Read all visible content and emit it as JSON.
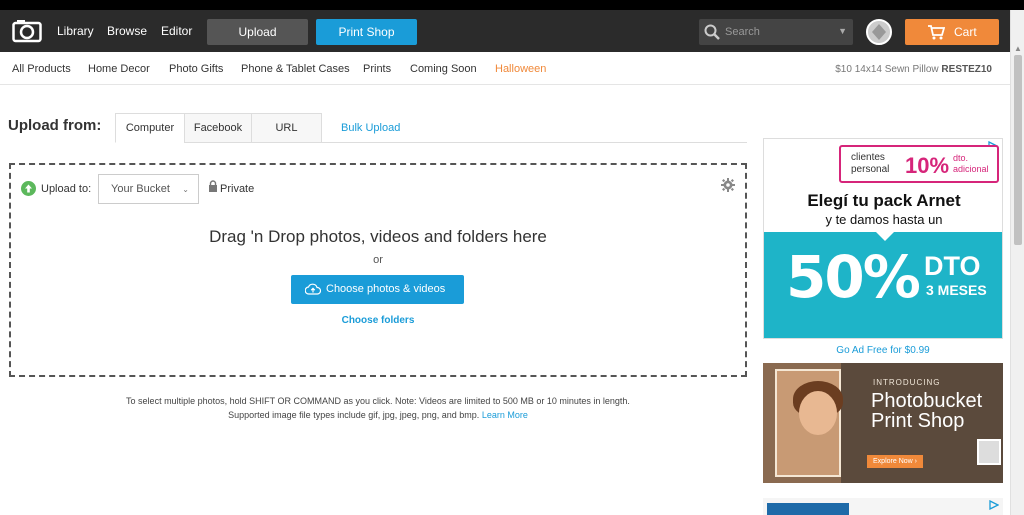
{
  "nav": {
    "items": [
      "Library",
      "Browse",
      "Editor"
    ],
    "upload_label": "Upload",
    "print_shop_label": "Print Shop",
    "search_placeholder": "Search",
    "cart_label": "Cart"
  },
  "categories": {
    "items": [
      "All Products",
      "Home Decor",
      "Photo Gifts",
      "Phone & Tablet Cases",
      "Prints",
      "Coming Soon",
      "Halloween"
    ],
    "promo_text": "$10 14x14 Sewn Pillow",
    "promo_code": "RESTEZ10"
  },
  "upload": {
    "heading": "Upload from:",
    "tabs": [
      "Computer",
      "Facebook",
      "URL"
    ],
    "bulk_label": "Bulk Upload",
    "upload_to_label": "Upload to:",
    "bucket_value": "Your Bucket",
    "privacy_label": "Private",
    "drag_title": "Drag 'n Drop photos, videos and folders here",
    "or_label": "or",
    "choose_button": "Choose photos & videos",
    "choose_folders": "Choose folders",
    "note_line1": "To select multiple photos, hold SHIFT OR COMMAND as you click. Note: Videos are limited to 500 MB or 10 minutes in length.",
    "note_line2": "Supported image file types include gif, jpg, jpeg, png, and bmp.",
    "learn_more": "Learn More"
  },
  "ads": {
    "ad1": {
      "badge_a": "clientes personal",
      "badge_b": "10%",
      "badge_c": "dto. adicional",
      "headline": "Elegí tu pack Arnet",
      "sub": "y te damos hasta un",
      "pct": "50%",
      "dto": "DTO",
      "meses": "3 MESES"
    },
    "ad_free": "Go Ad Free for $0.99",
    "ad2": {
      "intro": "INTRODUCING",
      "brand_line1": "Photobucket",
      "brand_line2": "Print Shop",
      "button": "Explore Now ›"
    }
  },
  "colors": {
    "accent_blue": "#1a9cd8",
    "accent_orange": "#f0893a",
    "topbar": "#2b2b2b",
    "ad_teal": "#1eb4c8",
    "ad_pink": "#d6257a"
  }
}
